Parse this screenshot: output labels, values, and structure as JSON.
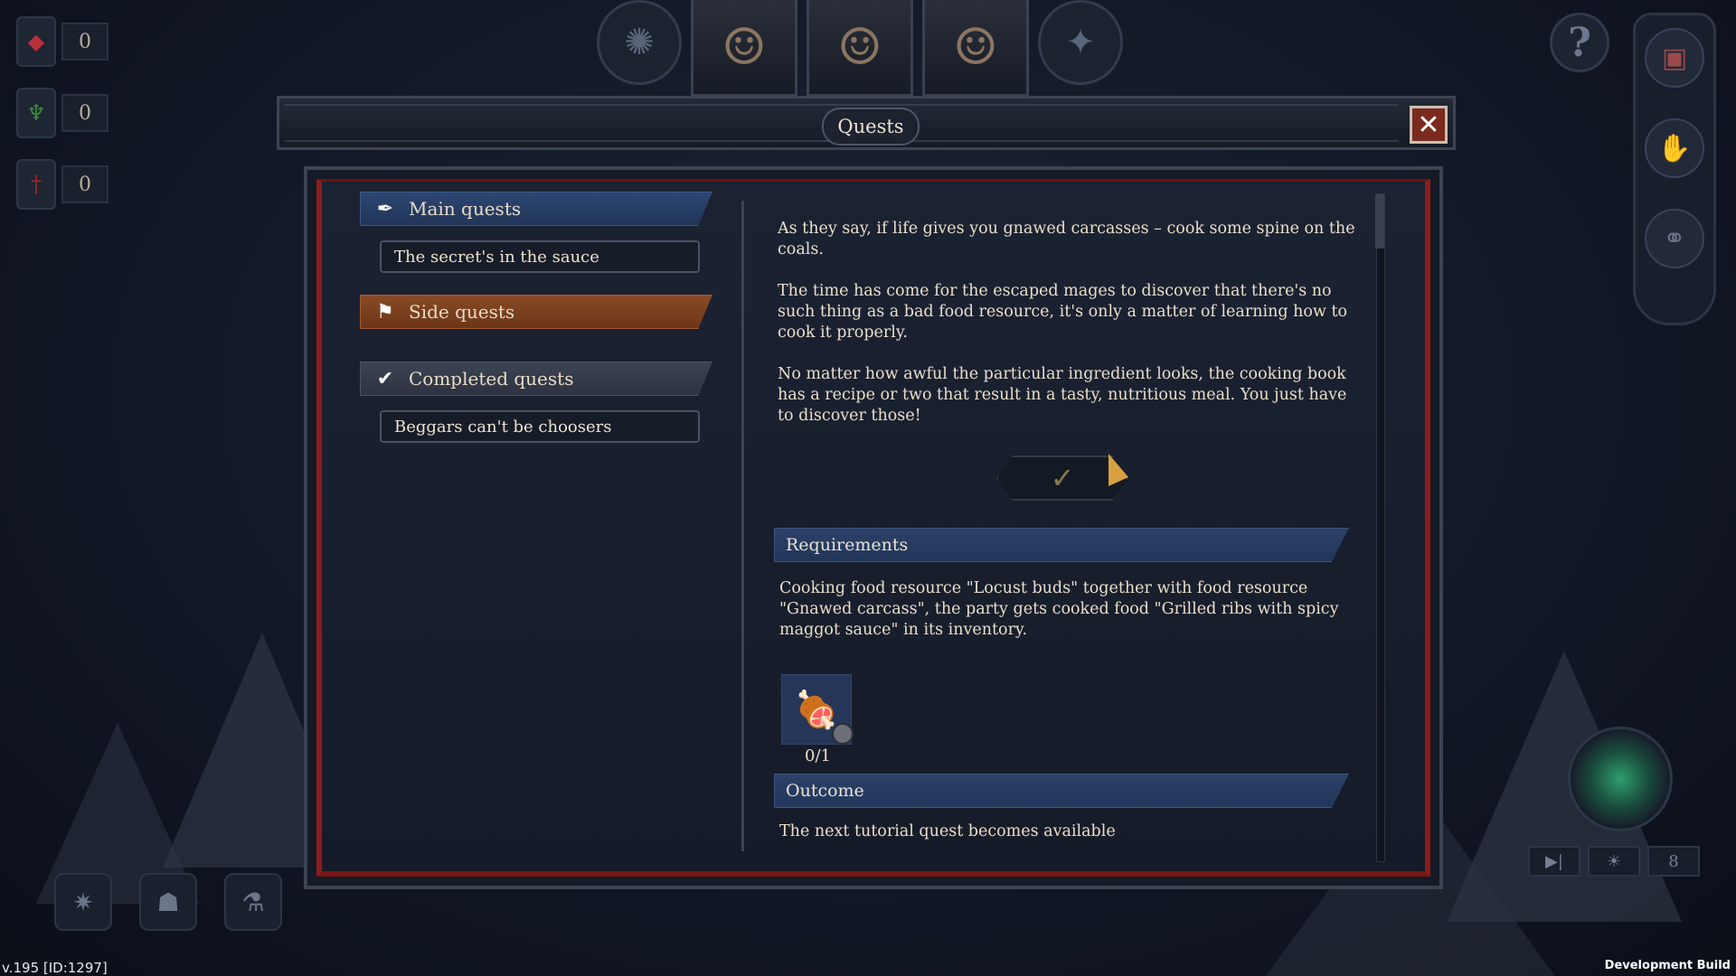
{
  "hud": {
    "resources": [
      {
        "icon": "red-gem-icon",
        "glyph": "◆",
        "color": "#b8303a",
        "value": "0"
      },
      {
        "icon": "green-staff-icon",
        "glyph": "♆",
        "color": "#3e8a3e",
        "value": "0"
      },
      {
        "icon": "red-sword-icon",
        "glyph": "†",
        "color": "#a02a2a",
        "value": "0"
      }
    ],
    "version": "v.195 [ID:1297]",
    "dev_build": "Development Build",
    "speed_value": "8"
  },
  "dialog": {
    "title": "Quests",
    "close_glyph": "✕",
    "categories": {
      "main": {
        "label": "Main quests",
        "icon": "feather-icon",
        "glyph": "✒"
      },
      "side": {
        "label": "Side quests",
        "icon": "flag-icon",
        "glyph": "⚑"
      },
      "completed": {
        "label": "Completed quests",
        "icon": "checkmark-icon",
        "glyph": "✔"
      }
    },
    "quests": {
      "main_item": "The secret's in the sauce",
      "completed_item": "Beggars can't be choosers"
    },
    "description": [
      "As they say, if life gives you gnawed carcasses – cook some spine on the coals.",
      "The time has come for the escaped mages to discover that there's no such thing as a bad food resource, it's only a matter of learning how to cook it properly.",
      "No matter how awful the particular ingredient looks, the cooking book has a recipe or two that result in a tasty, nutritious meal. You just have to discover those!"
    ],
    "confirm_glyph": "✓",
    "requirements": {
      "heading": "Requirements",
      "text": "Cooking food resource \"Locust buds\" together with food resource \"Gnawed carcass\", the party gets cooked food \"Grilled ribs with spicy maggot sauce\" in its inventory.",
      "item_icon": "grilled-ribs-icon",
      "item_glyph": "🍖",
      "progress": "0/1"
    },
    "outcome": {
      "heading": "Outcome",
      "text": "The next tutorial quest becomes available"
    }
  }
}
